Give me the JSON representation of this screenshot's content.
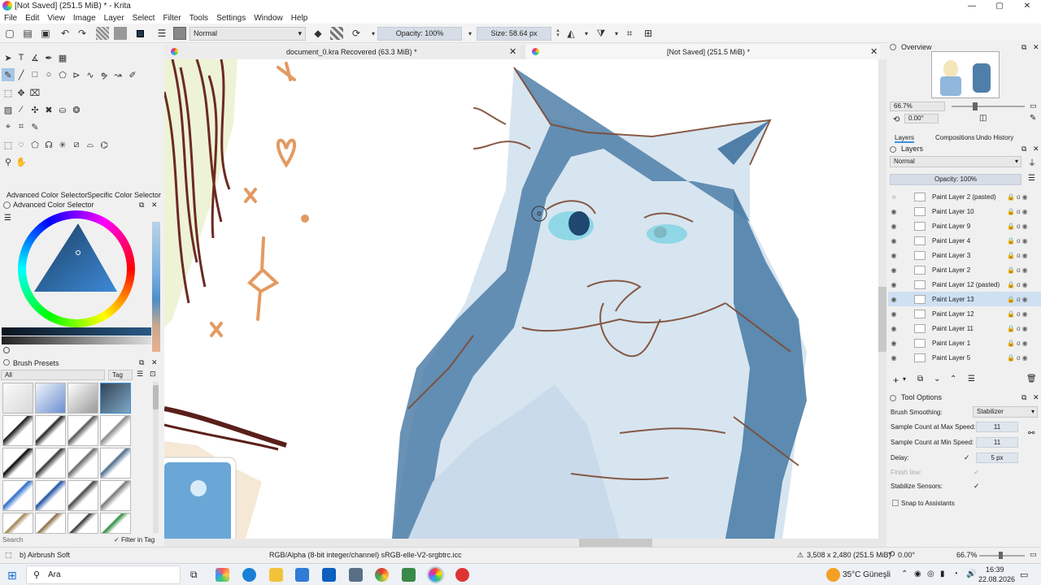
{
  "window": {
    "title": "[Not Saved]  (251.5 MiB) * - Krita",
    "min": "—",
    "max": "▢",
    "close": "✕"
  },
  "menu": [
    "File",
    "Edit",
    "View",
    "Image",
    "Layer",
    "Select",
    "Filter",
    "Tools",
    "Settings",
    "Window",
    "Help"
  ],
  "toolbar": {
    "blend_mode": "Normal",
    "opacity": "Opacity: 100%",
    "size": "Size: 58.64 px"
  },
  "colors": {
    "accent": "#3d8fd6",
    "canvas_cat": "#4f7fa8",
    "highlight": "#cfe0f2"
  },
  "docking_tabs": {
    "advanced": "Advanced Color Selector",
    "specific": "Specific Color Selector",
    "panel_title": "Advanced Color Selector"
  },
  "brush_presets": {
    "title": "Brush Presets",
    "filter": "All",
    "tag": "Tag",
    "search": "Search",
    "filter_in_tag": "Filter in Tag"
  },
  "documents": [
    {
      "title": "document_0.kra Recovered (63.3 MiB) *",
      "close": "✕"
    },
    {
      "title": "[Not Saved]  (251.5 MiB) *",
      "close": "✕"
    }
  ],
  "overview": {
    "title": "Overview",
    "zoom": "66.7%",
    "rotation": "0.00°"
  },
  "layer_tabs": [
    "Layers",
    "Compositions",
    "Undo History"
  ],
  "layers": {
    "title": "Layers",
    "blend": "Normal",
    "opacity": "Opacity: 100%",
    "items": [
      {
        "name": "Paint Layer 2 (pasted)",
        "visible": false,
        "selected": false
      },
      {
        "name": "Paint Layer 10",
        "visible": true,
        "selected": false
      },
      {
        "name": "Paint Layer 9",
        "visible": true,
        "selected": false
      },
      {
        "name": "Paint Layer 4",
        "visible": true,
        "selected": false
      },
      {
        "name": "Paint Layer 3",
        "visible": true,
        "selected": false
      },
      {
        "name": "Paint Layer 2",
        "visible": true,
        "selected": false
      },
      {
        "name": "Paint Layer 12 (pasted)",
        "visible": true,
        "selected": false
      },
      {
        "name": "Paint Layer 13",
        "visible": true,
        "selected": true
      },
      {
        "name": "Paint Layer 12",
        "visible": true,
        "selected": false
      },
      {
        "name": "Paint Layer 11",
        "visible": true,
        "selected": false
      },
      {
        "name": "Paint Layer 1",
        "visible": true,
        "selected": false
      },
      {
        "name": "Paint Layer 5",
        "visible": true,
        "selected": false
      }
    ]
  },
  "tool_options": {
    "title": "Tool Options",
    "brush_smoothing_label": "Brush Smoothing:",
    "brush_smoothing_value": "Stabilizer",
    "max_speed_label": "Sample Count at Max Speed:",
    "max_speed_value": "11",
    "min_speed_label": "Sample Count at Min Speed:",
    "min_speed_value": "11",
    "delay_label": "Delay:",
    "delay_value": "5 px",
    "finish_line_label": "Finish line:",
    "stabilize_sensors_label": "Stabilize Sensors:",
    "snap_label": "Snap to Assistants"
  },
  "status": {
    "brush": "b) Airbrush Soft",
    "color_space": "RGB/Alpha (8-bit integer/channel)  sRGB-elle-V2-srgbtrc.icc",
    "dimensions": "3,508 x 2,480 (251.5 MiB)",
    "rotation": "0.00°",
    "zoom": "66.7%"
  },
  "taskbar": {
    "search": "Ara",
    "weather": "35°C  Güneşli",
    "time": "16:39",
    "date": "22.08.2026"
  }
}
